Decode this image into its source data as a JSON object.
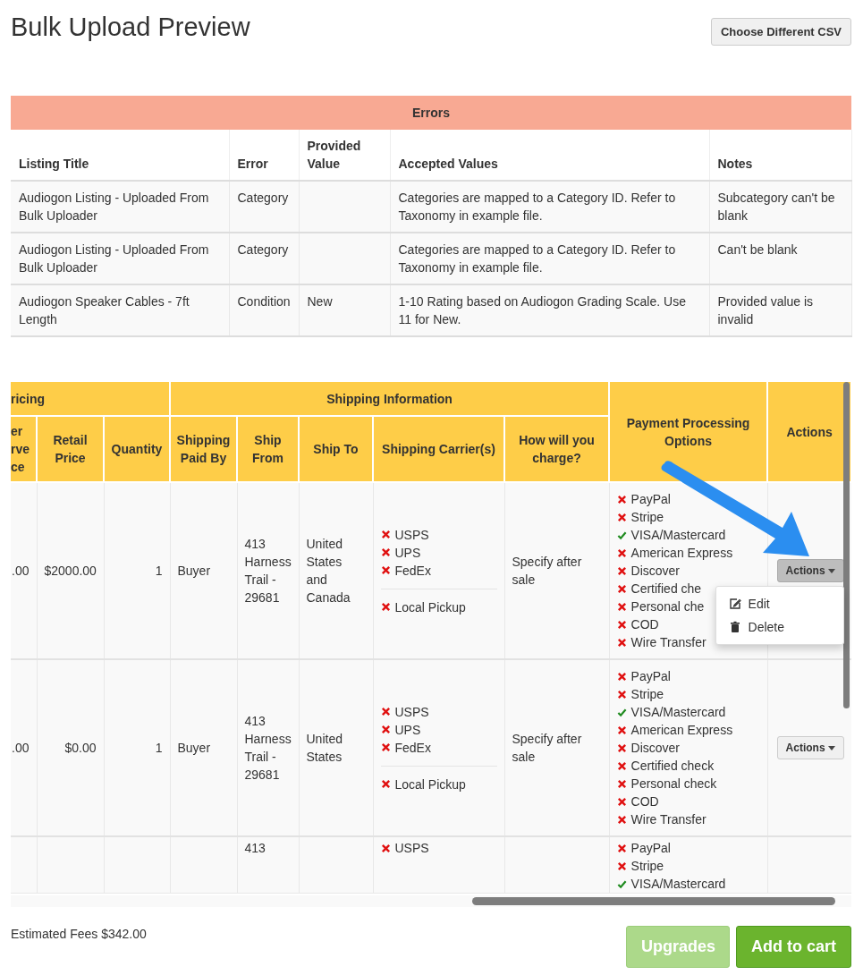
{
  "page": {
    "title": "Bulk Upload Preview",
    "choose_button": "Choose Different CSV"
  },
  "errors_table": {
    "title": "Errors",
    "columns": [
      "Listing Title",
      "Error",
      "Provided Value",
      "Accepted Values",
      "Notes"
    ],
    "rows": [
      [
        "Audiogon Listing - Uploaded From Bulk Uploader",
        "Category",
        null,
        "Categories are mapped to a Category ID. Refer to Taxonomy in example file.",
        "Subcategory can't be blank"
      ],
      [
        "Audiogon Listing - Uploaded From Bulk Uploader",
        "Category",
        null,
        "Categories are mapped to a Category ID. Refer to Taxonomy in example file.",
        "Can't be blank"
      ],
      [
        "Audiogon Speaker Cables - 7ft Length",
        "Condition",
        "New",
        "1-10 Rating based on Audiogon Grading Scale. Use 11 for New.",
        "Provided value is invalid"
      ]
    ]
  },
  "listings_table": {
    "groups": [
      {
        "label": "ricing"
      },
      {
        "label": "Shipping Information"
      }
    ],
    "columns": [
      "er rve ce",
      "Retail Price",
      "Quantity",
      "Shipping Paid By",
      "Ship From",
      "Ship To",
      "Shipping Carrier(s)",
      "How will you charge?"
    ],
    "spanning_columns": [
      "Payment Processing Options",
      "Actions"
    ],
    "rows": [
      {
        "cells": [
          ".00",
          "$2000.00",
          "1",
          "Buyer",
          "413 Harness Trail - 29681",
          "United States and Canada"
        ],
        "carriers": [
          {
            "name": "USPS",
            "accepted": false
          },
          {
            "name": "UPS",
            "accepted": false
          },
          {
            "name": "FedEx",
            "accepted": false
          }
        ],
        "local_pickup": {
          "name": "Local Pickup",
          "accepted": false
        },
        "charge": "Specify after sale",
        "payments": [
          {
            "name": "PayPal",
            "accepted": false
          },
          {
            "name": "Stripe",
            "accepted": false
          },
          {
            "name": "VISA/Mastercard",
            "accepted": true
          },
          {
            "name": "American Express",
            "accepted": false
          },
          {
            "name": "Discover",
            "accepted": false
          },
          {
            "name": "Certified che",
            "accepted": false
          },
          {
            "name": "Personal che",
            "accepted": false
          },
          {
            "name": "COD",
            "accepted": false
          },
          {
            "name": "Wire Transfer",
            "accepted": false
          }
        ],
        "actions": {
          "label": "Actions",
          "menu_open": true,
          "menu": [
            {
              "kind": "edit",
              "label": "Edit"
            },
            {
              "kind": "delete",
              "label": "Delete"
            }
          ]
        }
      },
      {
        "cells": [
          ".00",
          "$0.00",
          "1",
          "Buyer",
          "413 Harness Trail - 29681",
          "United States"
        ],
        "carriers": [
          {
            "name": "USPS",
            "accepted": false
          },
          {
            "name": "UPS",
            "accepted": false
          },
          {
            "name": "FedEx",
            "accepted": false
          }
        ],
        "local_pickup": {
          "name": "Local Pickup",
          "accepted": false
        },
        "charge": "Specify after sale",
        "payments": [
          {
            "name": "PayPal",
            "accepted": false
          },
          {
            "name": "Stripe",
            "accepted": false
          },
          {
            "name": "VISA/Mastercard",
            "accepted": true
          },
          {
            "name": "American Express",
            "accepted": false
          },
          {
            "name": "Discover",
            "accepted": false
          },
          {
            "name": "Certified check",
            "accepted": false
          },
          {
            "name": "Personal check",
            "accepted": false
          },
          {
            "name": "COD",
            "accepted": false
          },
          {
            "name": "Wire Transfer",
            "accepted": false
          }
        ],
        "actions": {
          "label": "Actions",
          "menu_open": false
        }
      },
      {
        "cells": [
          null,
          null,
          null,
          null,
          "413",
          null
        ],
        "carriers": [
          {
            "name": "USPS",
            "accepted": false
          }
        ],
        "payments": [
          {
            "name": "PayPal",
            "accepted": false
          },
          {
            "name": "Stripe",
            "accepted": false
          },
          {
            "name": "VISA/Mastercard",
            "accepted": true
          }
        ]
      }
    ]
  },
  "footer": {
    "fees": "Estimated Fees $342.00",
    "buttons": [
      {
        "label": "Upgrades",
        "kind": "secondary",
        "disabled": true
      },
      {
        "label": "Add to cart",
        "kind": "primary",
        "disabled": false
      }
    ]
  }
}
